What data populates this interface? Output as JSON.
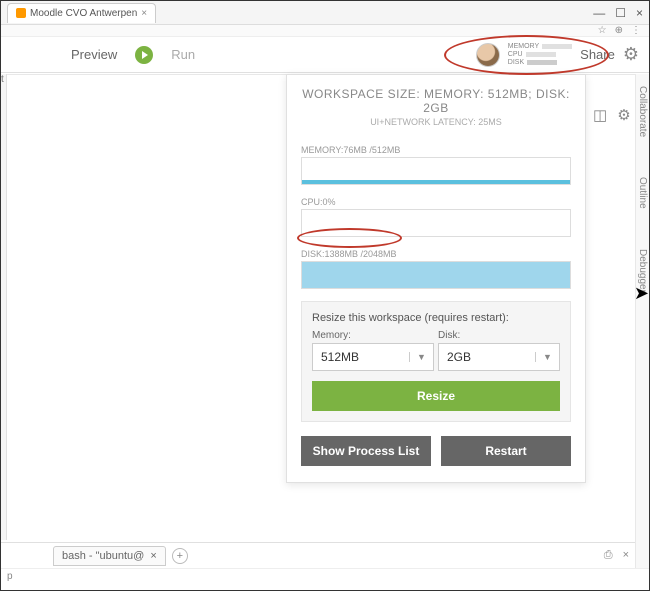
{
  "browser": {
    "tab_title": "Moodle CVO Antwerpen",
    "tab_close": "×",
    "min": "—",
    "restore": "☐",
    "close": "×",
    "addr_star": "☆",
    "addr_zoom": "⊕",
    "addr_menu": "⋮"
  },
  "toolbar": {
    "preview": "Preview",
    "run": "Run",
    "share": "Share",
    "stats": {
      "memory": "MEMORY",
      "cpu": "CPU",
      "disk": "DISK"
    }
  },
  "panel": {
    "title": "WORKSPACE SIZE: MEMORY: 512MB; DISK: 2GB",
    "latency": "UI+NETWORK LATENCY: 25MS",
    "memory_label": "MEMORY:76MB /512MB",
    "cpu_label": "CPU:0%",
    "disk_label": "DISK:1388MB /2048MB",
    "resize_title": "Resize this workspace (requires restart):",
    "memory_sel_label": "Memory:",
    "disk_sel_label": "Disk:",
    "memory_value": "512MB",
    "disk_value": "2GB",
    "resize_btn": "Resize",
    "show_process": "Show Process List",
    "restart": "Restart"
  },
  "sidebar": {
    "collaborate": "Collaborate",
    "outline": "Outline",
    "debugger": "Debugger"
  },
  "terminal": {
    "tab": "bash - \"ubuntu@",
    "close": "×",
    "add": "+",
    "printer": "⎙",
    "close2": "×"
  },
  "status": {
    "p": "p"
  },
  "left": {
    "t": "t"
  }
}
